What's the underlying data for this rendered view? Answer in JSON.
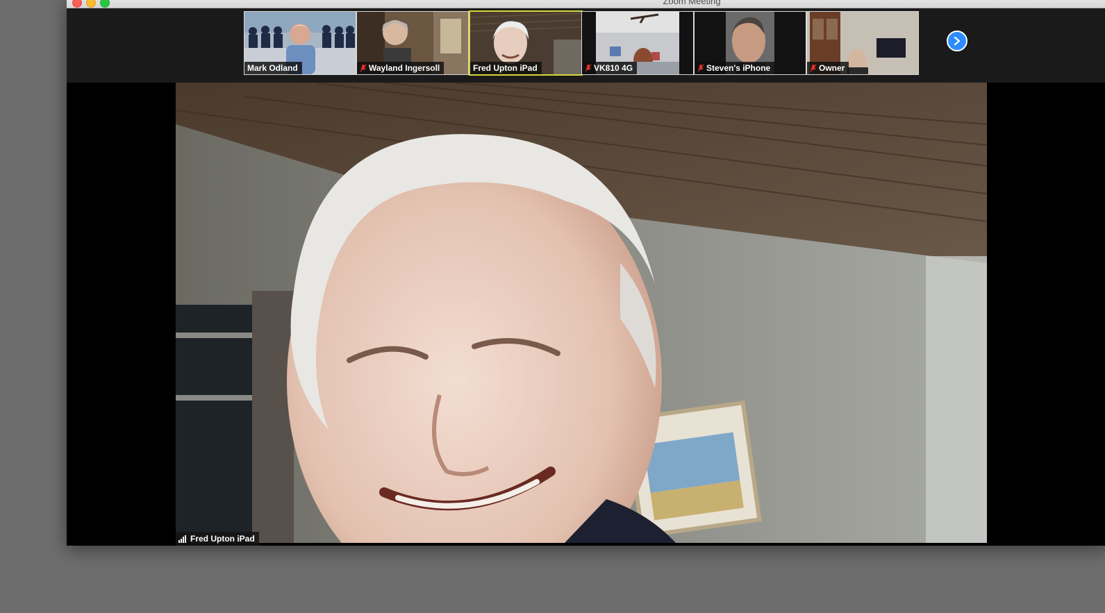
{
  "window": {
    "title": "Zoom Meeting"
  },
  "gallery": {
    "participants": [
      {
        "name": "Mark Odland",
        "muted": false,
        "active": false
      },
      {
        "name": "Wayland Ingersoll",
        "muted": true,
        "active": false
      },
      {
        "name": "Fred Upton iPad",
        "muted": false,
        "active": true
      },
      {
        "name": "VK810 4G",
        "muted": true,
        "active": false
      },
      {
        "name": "Steven's iPhone",
        "muted": true,
        "active": false
      },
      {
        "name": "Owner",
        "muted": true,
        "active": false
      }
    ],
    "next_icon": "chevron-right-icon"
  },
  "speaker": {
    "name": "Fred Upton iPad",
    "signal_icon": "signal-bars-icon"
  },
  "colors": {
    "accent": "#2d8cff",
    "active_border": "#d6d63a",
    "mute": "#e0302a"
  }
}
